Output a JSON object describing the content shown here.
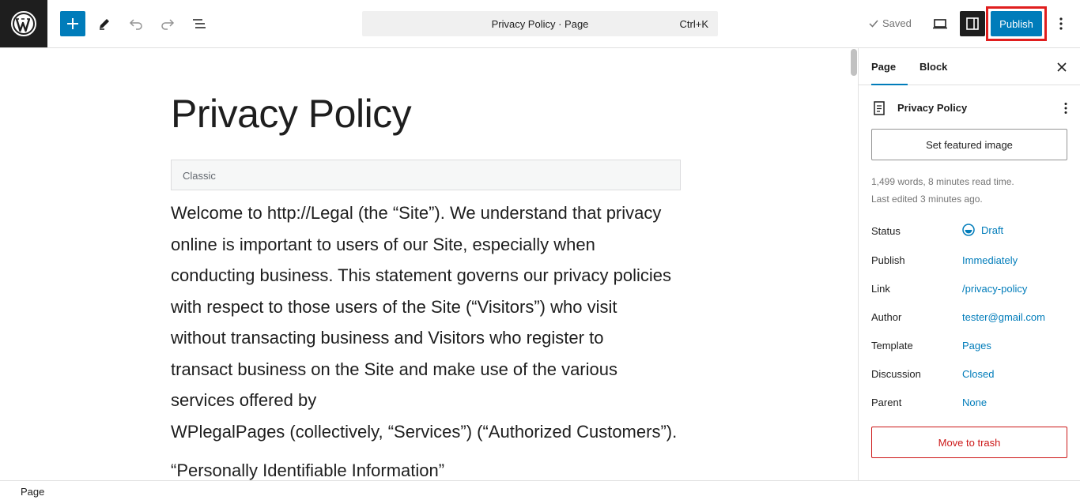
{
  "toolbar": {
    "document_title": "Privacy Policy · Page",
    "shortcut": "Ctrl+K",
    "saved_label": "Saved",
    "publish_label": "Publish"
  },
  "editor": {
    "title": "Privacy Policy",
    "classic_label": "Classic",
    "paragraph_lines": [
      "Welcome to http://Legal (the “Site”). We understand that privacy",
      "online is important to users of our Site, especially when",
      "conducting business. This statement governs our privacy policies",
      "with respect to those users of the Site (“Visitors”) who visit",
      "without transacting business and Visitors who register to",
      "transact business on the Site and make use of the various",
      "services offered by",
      "WPlegalPages (collectively, “Services”) (“Authorized Customers”)."
    ],
    "subheading": "“Personally Identifiable Information”"
  },
  "sidebar": {
    "tab_page": "Page",
    "tab_block": "Block",
    "doc_title": "Privacy Policy",
    "featured_image_label": "Set featured image",
    "meta_words": "1,499 words, 8 minutes read time.",
    "meta_edited": "Last edited 3 minutes ago.",
    "fields": {
      "status": {
        "label": "Status",
        "value": "Draft"
      },
      "publish": {
        "label": "Publish",
        "value": "Immediately"
      },
      "link": {
        "label": "Link",
        "value": "/privacy-policy"
      },
      "author": {
        "label": "Author",
        "value": "tester@gmail.com"
      },
      "template": {
        "label": "Template",
        "value": "Pages"
      },
      "discussion": {
        "label": "Discussion",
        "value": "Closed"
      },
      "parent": {
        "label": "Parent",
        "value": "None"
      }
    },
    "trash_label": "Move to trash"
  },
  "footer": {
    "breadcrumb": "Page"
  },
  "colors": {
    "accent": "#007cba",
    "highlight": "#e01e1e",
    "danger": "#cc1818"
  }
}
